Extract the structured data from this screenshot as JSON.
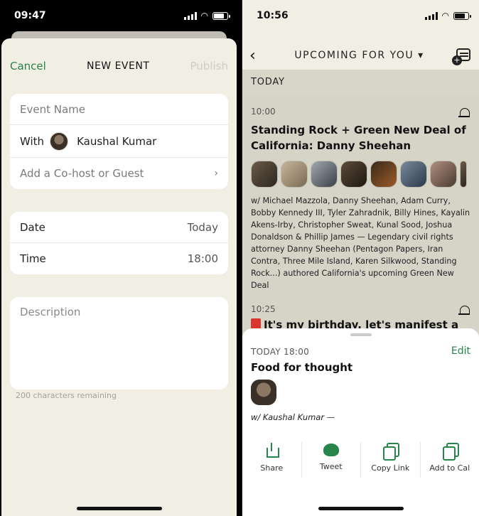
{
  "left": {
    "status_time": "09:47",
    "nav": {
      "cancel": "Cancel",
      "title": "NEW EVENT",
      "publish": "Publish"
    },
    "details": {
      "event_name_placeholder": "Event Name",
      "with_label": "With",
      "host_name": "Kaushal Kumar",
      "add_cohost": "Add a Co-host or Guest"
    },
    "schedule": {
      "date_label": "Date",
      "date_value": "Today",
      "time_label": "Time",
      "time_value": "18:00"
    },
    "description": {
      "placeholder": "Description",
      "remaining": "200 characters remaining"
    }
  },
  "right": {
    "status_time": "10:56",
    "nav": {
      "title": "UPCOMING FOR YOU ▾"
    },
    "section": "TODAY",
    "events": [
      {
        "time": "10:00",
        "title": "Standing Rock + Green New Deal of California: Danny Sheehan",
        "description": "w/ Michael Mazzola, Danny Sheehan, Adam Curry, Bobby Kennedy III, Tyler Zahradnik, Billy Hines, Kayalin Akens-Irby, Christopher Sweat, Kunal Sood, Joshua Donaldson & Phillip James — Legendary civil rights attorney Danny Sheehan (Pentagon Papers, Iran Contra, Three Mile Island, Karen Silkwood, Standing Rock...) authored California's upcoming Green New Deal"
      },
      {
        "time": "10:25",
        "title": "It's my birthday, let's manifest a"
      }
    ],
    "sheet": {
      "time": "TODAY 18:00",
      "edit": "Edit",
      "title": "Food for thought",
      "with": "w/ Kaushal Kumar —",
      "actions": [
        "Share",
        "Tweet",
        "Copy Link",
        "Add to Cal"
      ]
    }
  },
  "colors": {
    "accent": "#27844a",
    "background": "#f1efe4"
  }
}
